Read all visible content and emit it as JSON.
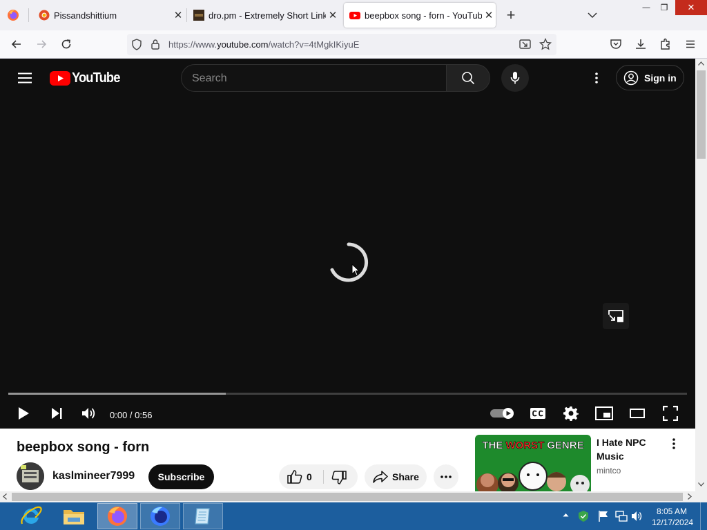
{
  "browser": {
    "tabs": [
      {
        "title": "Pissandshittium",
        "close": "✕"
      },
      {
        "title": "dro.pm - Extremely Short Links",
        "close": "✕"
      },
      {
        "title": "beepbox song - forn - YouTube",
        "close": "✕"
      }
    ],
    "new_tab": "+",
    "url_prefix": "https://www.",
    "url_domain": "youtube.com",
    "url_suffix": "/watch?v=4tMgkIKiyuE",
    "window_controls": {
      "minimize": "—",
      "restore": "❐",
      "close": "✕"
    }
  },
  "youtube": {
    "logo_text": "YouTube",
    "search_placeholder": "Search",
    "sign_in": "Sign in",
    "player": {
      "time": "0:00 / 0:56",
      "progress_buffered": 0.32
    },
    "video": {
      "title": "beepbox song - forn",
      "channel": "kaslmineer7999",
      "subscribe": "Subscribe",
      "likes": "0",
      "share": "Share"
    },
    "recommended": {
      "title": "I Hate NPC Music",
      "channel": "mintco",
      "thumb_text_1": "THE",
      "thumb_text_2": "WORST",
      "thumb_text_3": "GENRE"
    }
  },
  "taskbar": {
    "time": "8:05 AM",
    "date": "12/17/2024"
  },
  "colors": {
    "youtube_red": "#ff0000",
    "taskbar": "#1c5e9e",
    "yt_dark": "#0f0f0f"
  }
}
